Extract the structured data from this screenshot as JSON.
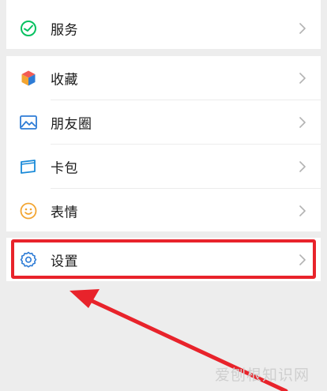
{
  "menu": {
    "service": {
      "label": "服务"
    },
    "favorites": {
      "label": "收藏"
    },
    "moments": {
      "label": "朋友圈"
    },
    "cards": {
      "label": "卡包"
    },
    "stickers": {
      "label": "表情"
    },
    "settings": {
      "label": "设置"
    }
  },
  "colors": {
    "background": "#ededed",
    "row_background": "#ffffff",
    "service_icon": "#07c160",
    "moments_icon": "#2e7cd6",
    "cards_icon": "#1a8ad8",
    "stickers_icon": "#f3a531",
    "settings_icon": "#2e7cd6",
    "annotation": "#e8232b"
  },
  "icons": {
    "service": "service-icon",
    "favorites": "cube-icon",
    "moments": "image-icon",
    "cards": "card-icon",
    "stickers": "smile-icon",
    "settings": "gear-icon",
    "chevron": "chevron-right-icon"
  },
  "watermark": {
    "text": "爱刨根知识网"
  }
}
